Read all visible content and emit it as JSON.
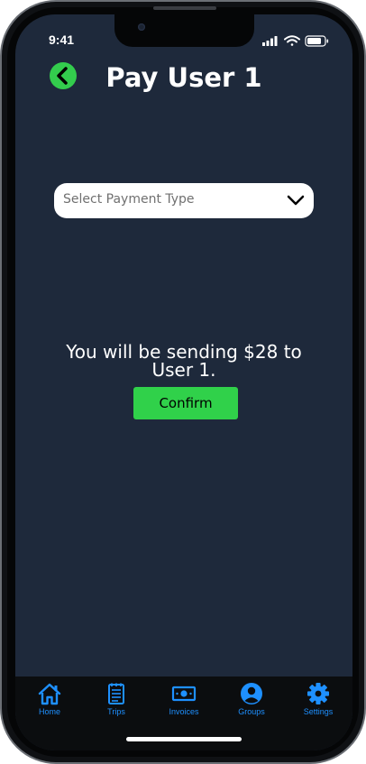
{
  "status_bar": {
    "time": "9:41"
  },
  "header": {
    "title": "Pay User 1"
  },
  "payment_select": {
    "placeholder": "Select Payment Type"
  },
  "message": {
    "text": "You will be sending $28 to User 1."
  },
  "confirm": {
    "label": "Confirm"
  },
  "tab_bar": {
    "items": [
      {
        "label": "Home",
        "icon": "home-icon"
      },
      {
        "label": "Trips",
        "icon": "notepad-icon"
      },
      {
        "label": "Invoices",
        "icon": "cash-icon"
      },
      {
        "label": "Groups",
        "icon": "user-circle-icon"
      },
      {
        "label": "Settings",
        "icon": "gear-icon"
      }
    ]
  },
  "colors": {
    "background": "#1e293b",
    "accent_green": "#30d14a",
    "tab_blue": "#1e90ff",
    "tab_bar": "#0b0d0f"
  }
}
